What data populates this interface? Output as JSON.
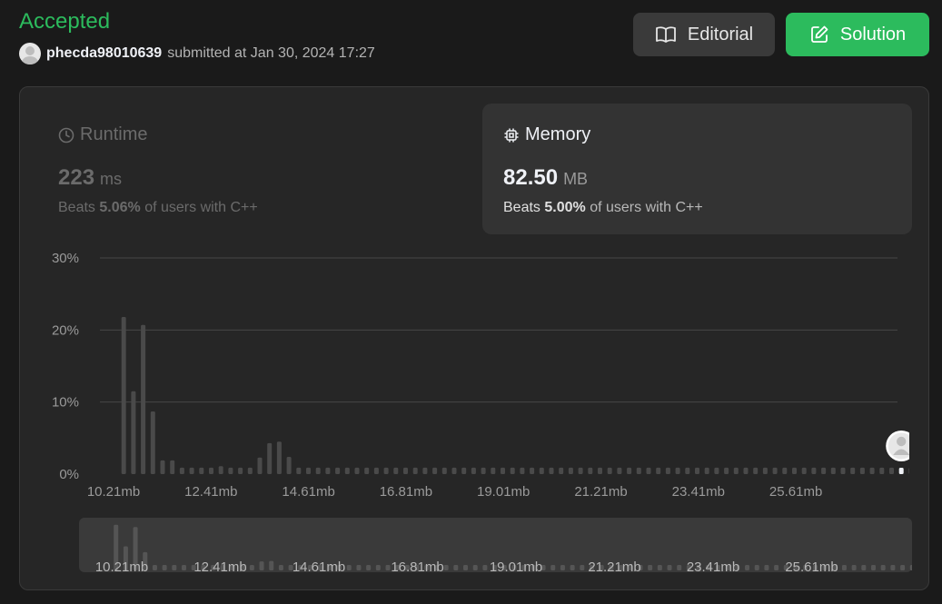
{
  "header": {
    "status": "Accepted",
    "username": "phecda98010639",
    "submitted_text": "submitted at Jan 30, 2024 17:27",
    "editorial_label": "Editorial",
    "solution_label": "Solution",
    "accent_color": "#2cbb5d"
  },
  "runtime": {
    "label": "Runtime",
    "value": "223",
    "unit": "ms",
    "beats_prefix": "Beats",
    "beats_pct": "5.06%",
    "beats_suffix": "of users with C++",
    "icon": "clock-icon"
  },
  "memory": {
    "label": "Memory",
    "value": "82.50",
    "unit": "MB",
    "beats_prefix": "Beats",
    "beats_pct": "5.00%",
    "beats_suffix": "of users with C++",
    "icon": "chip-icon"
  },
  "chart_data": {
    "type": "bar",
    "y_ticks": [
      "30%",
      "20%",
      "10%",
      "0%"
    ],
    "ylim": [
      0,
      30
    ],
    "x_tick_labels": [
      "10.21mb",
      "12.41mb",
      "14.61mb",
      "16.81mb",
      "19.01mb",
      "21.21mb",
      "23.41mb",
      "25.61mb"
    ],
    "values": [
      0,
      21.8,
      11.5,
      20.7,
      8.7,
      1.9,
      1.9,
      0.9,
      0.9,
      0.9,
      0.9,
      1.1,
      0.9,
      0.9,
      0.9,
      2.3,
      4.3,
      4.5,
      2.4,
      0.9,
      0.9,
      0.9,
      0.9,
      0.9,
      0.9,
      0.9,
      0.9,
      0.9,
      0.9,
      0.9,
      0.9,
      0.9,
      0.9,
      0.9,
      0.9,
      0.9,
      0.9,
      0.9,
      0.9,
      0.9,
      0.9,
      0.9,
      0.9,
      0.9,
      0.9,
      0.9,
      0.9,
      0.9,
      0.9,
      0.9,
      0.9,
      0.9,
      0.9,
      0.9,
      0.9,
      0.9,
      0.9,
      0.9,
      0.9,
      0.9,
      0.9,
      0.9,
      0.9,
      0.9,
      0.9,
      0.9,
      0.9,
      0.9,
      0.9,
      0.9,
      0.9,
      0.9,
      0.9,
      0.9,
      0.9,
      0.9,
      0.9,
      0.9,
      0.9,
      0.9,
      0.9,
      0.9,
      0.9,
      0.9
    ],
    "highlight_index": 81,
    "grid": true
  }
}
